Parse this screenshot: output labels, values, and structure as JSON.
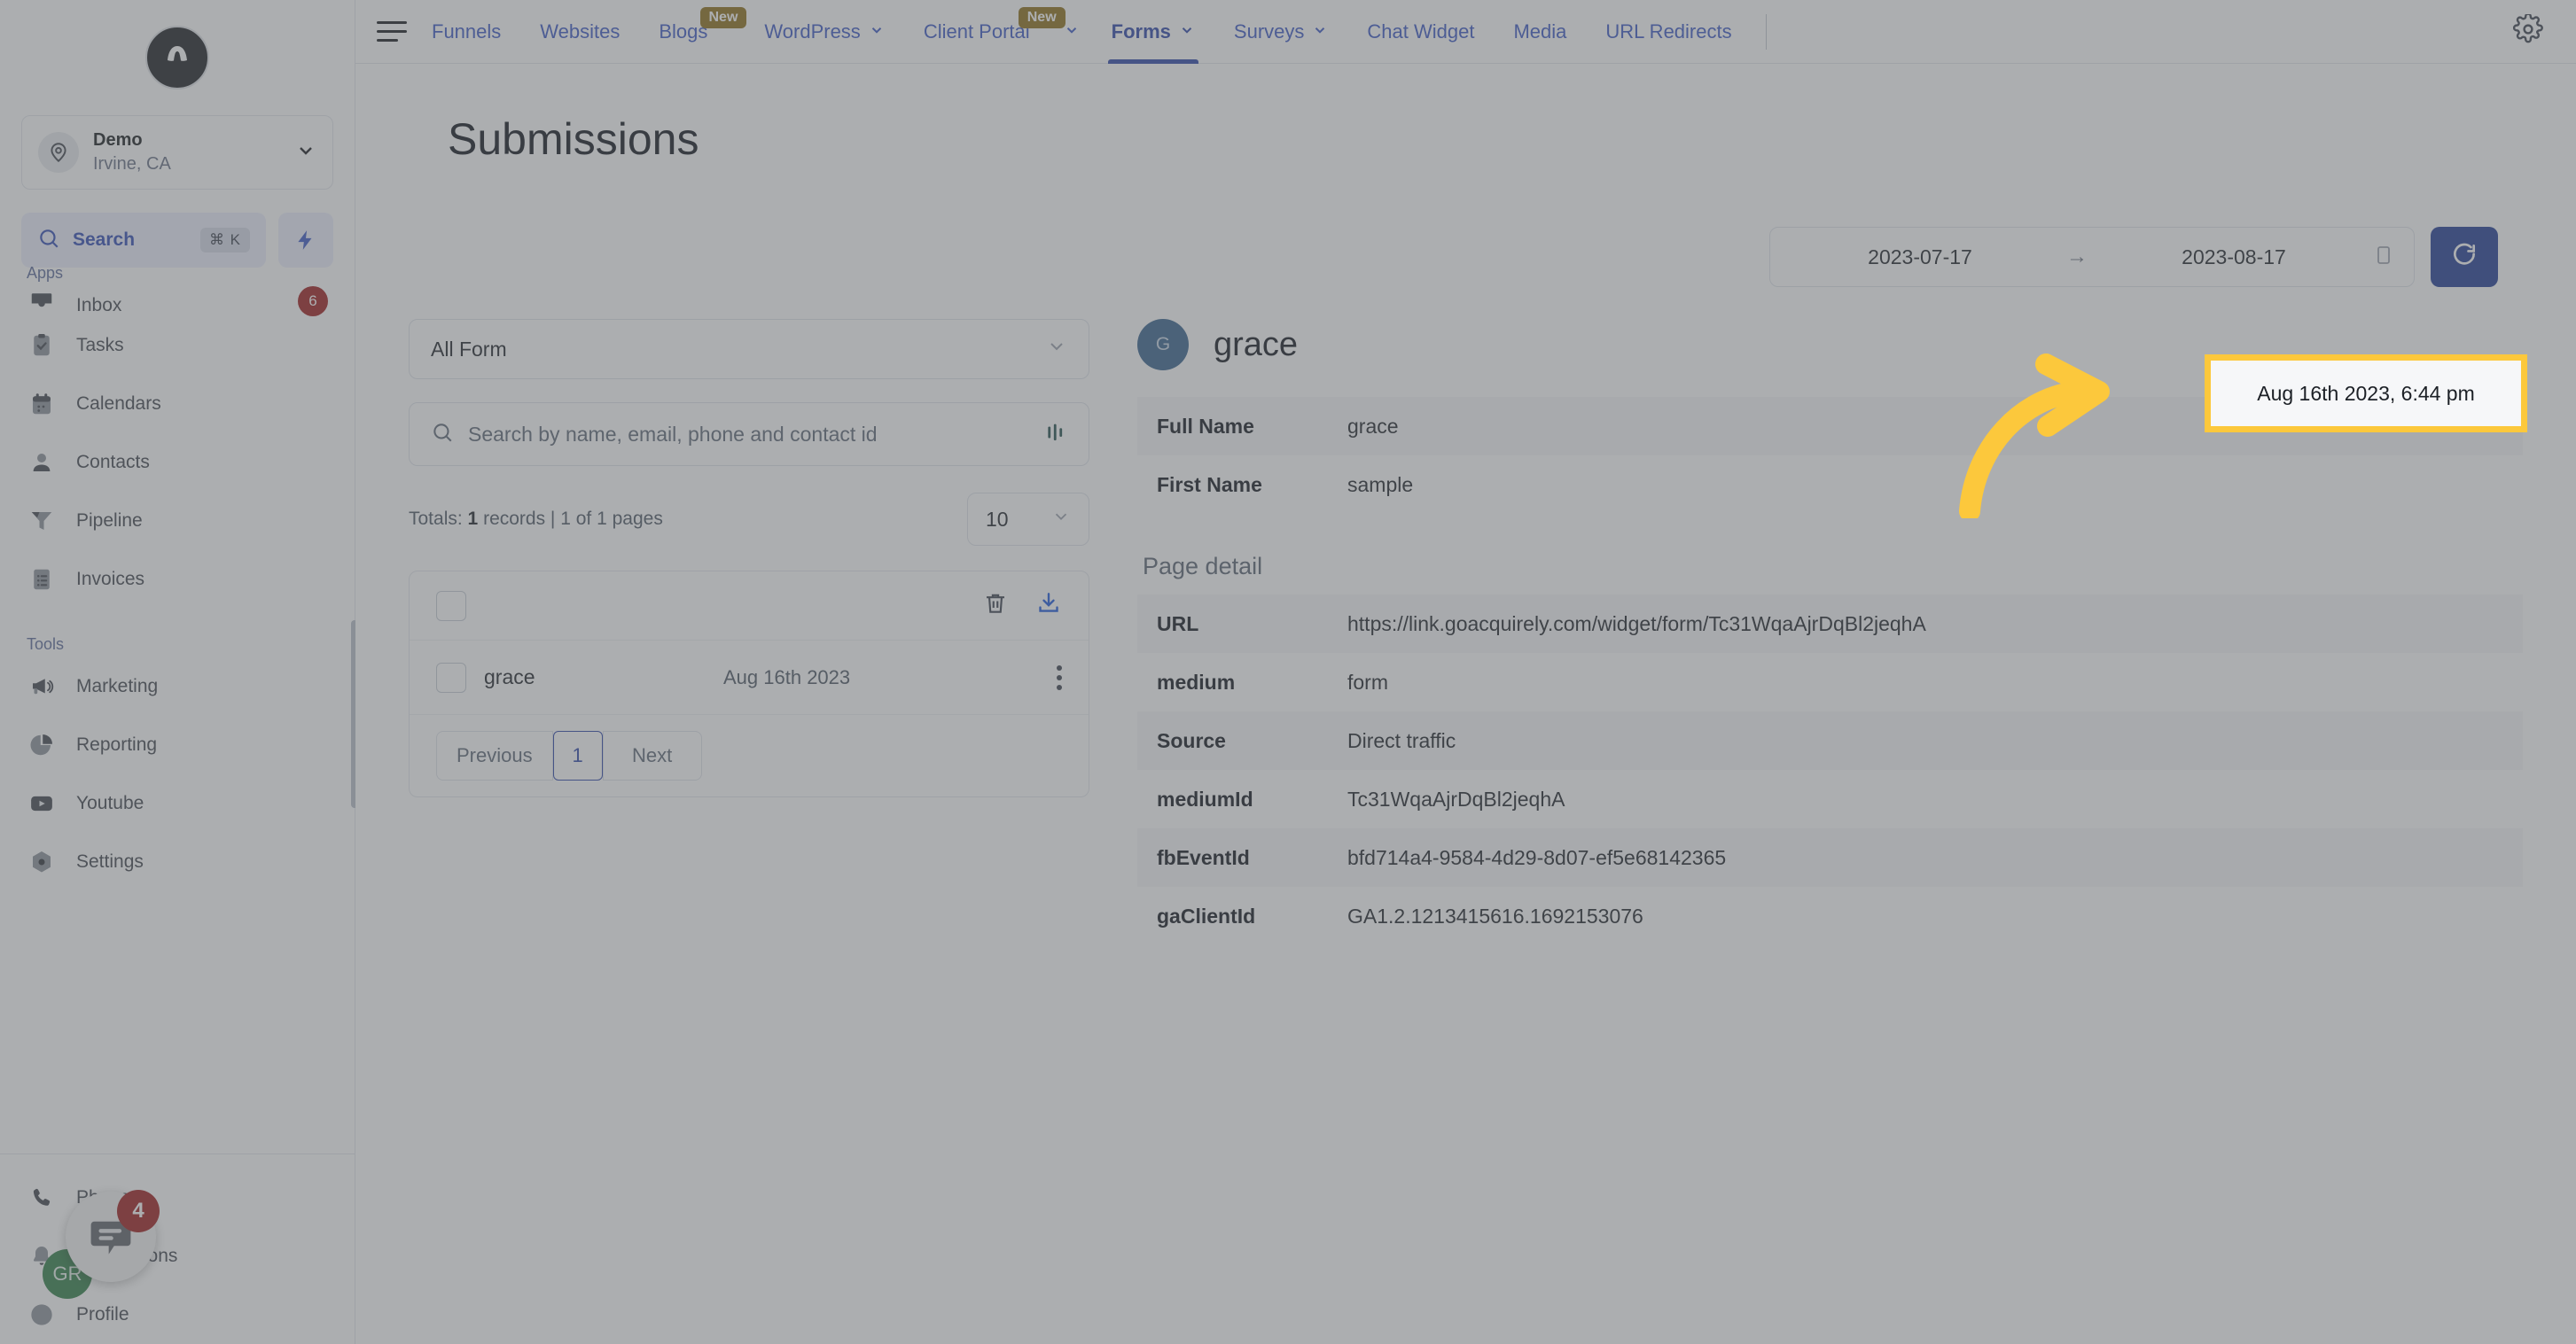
{
  "sidebar": {
    "brand_letter": "A",
    "location": {
      "name": "Demo",
      "sub": "Irvine, CA"
    },
    "search": {
      "label": "Search",
      "shortcut": "⌘ K"
    },
    "sections": [
      {
        "label": "Apps",
        "items": [
          {
            "label": "Inbox",
            "icon": "inbox-icon",
            "badge": "6",
            "clipped": true
          },
          {
            "label": "Tasks",
            "icon": "tasks-icon"
          },
          {
            "label": "Calendars",
            "icon": "calendar-icon"
          },
          {
            "label": "Contacts",
            "icon": "contacts-icon"
          },
          {
            "label": "Pipeline",
            "icon": "pipeline-icon"
          },
          {
            "label": "Invoices",
            "icon": "invoices-icon"
          }
        ]
      },
      {
        "label": "Tools",
        "items": [
          {
            "label": "Marketing",
            "icon": "megaphone-icon"
          },
          {
            "label": "Reporting",
            "icon": "pie-chart-icon"
          },
          {
            "label": "Youtube",
            "icon": "youtube-icon"
          },
          {
            "label": "Settings",
            "icon": "settings-gear-icon"
          }
        ]
      }
    ],
    "bottom_items": [
      {
        "label": "Phone",
        "icon": "phone-icon"
      },
      {
        "label": "Notifications",
        "icon": "bell-icon"
      },
      {
        "label": "Profile",
        "icon": "profile-icon"
      }
    ],
    "chat_widget": {
      "badge": "4"
    },
    "profile_avatar": "GR"
  },
  "topnav": {
    "items": [
      {
        "label": "Funnels",
        "caret": false,
        "badge": null,
        "active": false
      },
      {
        "label": "Websites",
        "caret": false,
        "badge": null,
        "active": false
      },
      {
        "label": "Blogs",
        "caret": false,
        "badge": "New",
        "active": false
      },
      {
        "label": "WordPress",
        "caret": true,
        "badge": null,
        "active": false
      },
      {
        "label": "Client Portal",
        "caret": true,
        "badge": "New",
        "active": false
      },
      {
        "label": "Forms",
        "caret": true,
        "badge": null,
        "active": true
      },
      {
        "label": "Surveys",
        "caret": true,
        "badge": null,
        "active": false
      },
      {
        "label": "Chat Widget",
        "caret": false,
        "badge": null,
        "active": false
      },
      {
        "label": "Media",
        "caret": false,
        "badge": null,
        "active": false
      },
      {
        "label": "URL Redirects",
        "caret": false,
        "badge": null,
        "active": false
      }
    ],
    "settings_icon": "gear-icon"
  },
  "page": {
    "title": "Submissions",
    "date_range": {
      "start": "2023-07-17",
      "end": "2023-08-17",
      "arrow": "→"
    },
    "refresh_icon": "refresh-icon"
  },
  "left_panel": {
    "form_select": "All Form",
    "search_placeholder": "Search by name, email, phone and contact id",
    "totals_prefix": "Totals:",
    "totals_count": "1",
    "totals_suffix": "records | 1 of 1 pages",
    "per_page": "10",
    "records": [
      {
        "name": "grace",
        "date": "Aug 16th 2023"
      }
    ],
    "pagination": {
      "previous": "Previous",
      "page": "1",
      "next": "Next"
    }
  },
  "detail": {
    "avatar_letter": "G",
    "name": "grace",
    "timestamp": "Aug 16th 2023, 6:44 pm",
    "fields": [
      {
        "key": "Full Name",
        "value": "grace"
      },
      {
        "key": "First Name",
        "value": "sample"
      }
    ],
    "page_detail_title": "Page detail",
    "page_detail": [
      {
        "key": "URL",
        "value": "https://link.goacquirely.com/widget/form/Tc31WqaAjrDqBl2jeqhA"
      },
      {
        "key": "medium",
        "value": "form"
      },
      {
        "key": "Source",
        "value": "Direct traffic"
      },
      {
        "key": "mediumId",
        "value": "Tc31WqaAjrDqBl2jeqhA"
      },
      {
        "key": "fbEventId",
        "value": "bfd714a4-9584-4d29-8d07-ef5e68142365"
      },
      {
        "key": "gaClientId",
        "value": "GA1.2.1213415616.1692153076"
      }
    ]
  },
  "annotation": {
    "highlight_color": "#fcc83c",
    "arrow_color": "#fcc83c"
  }
}
